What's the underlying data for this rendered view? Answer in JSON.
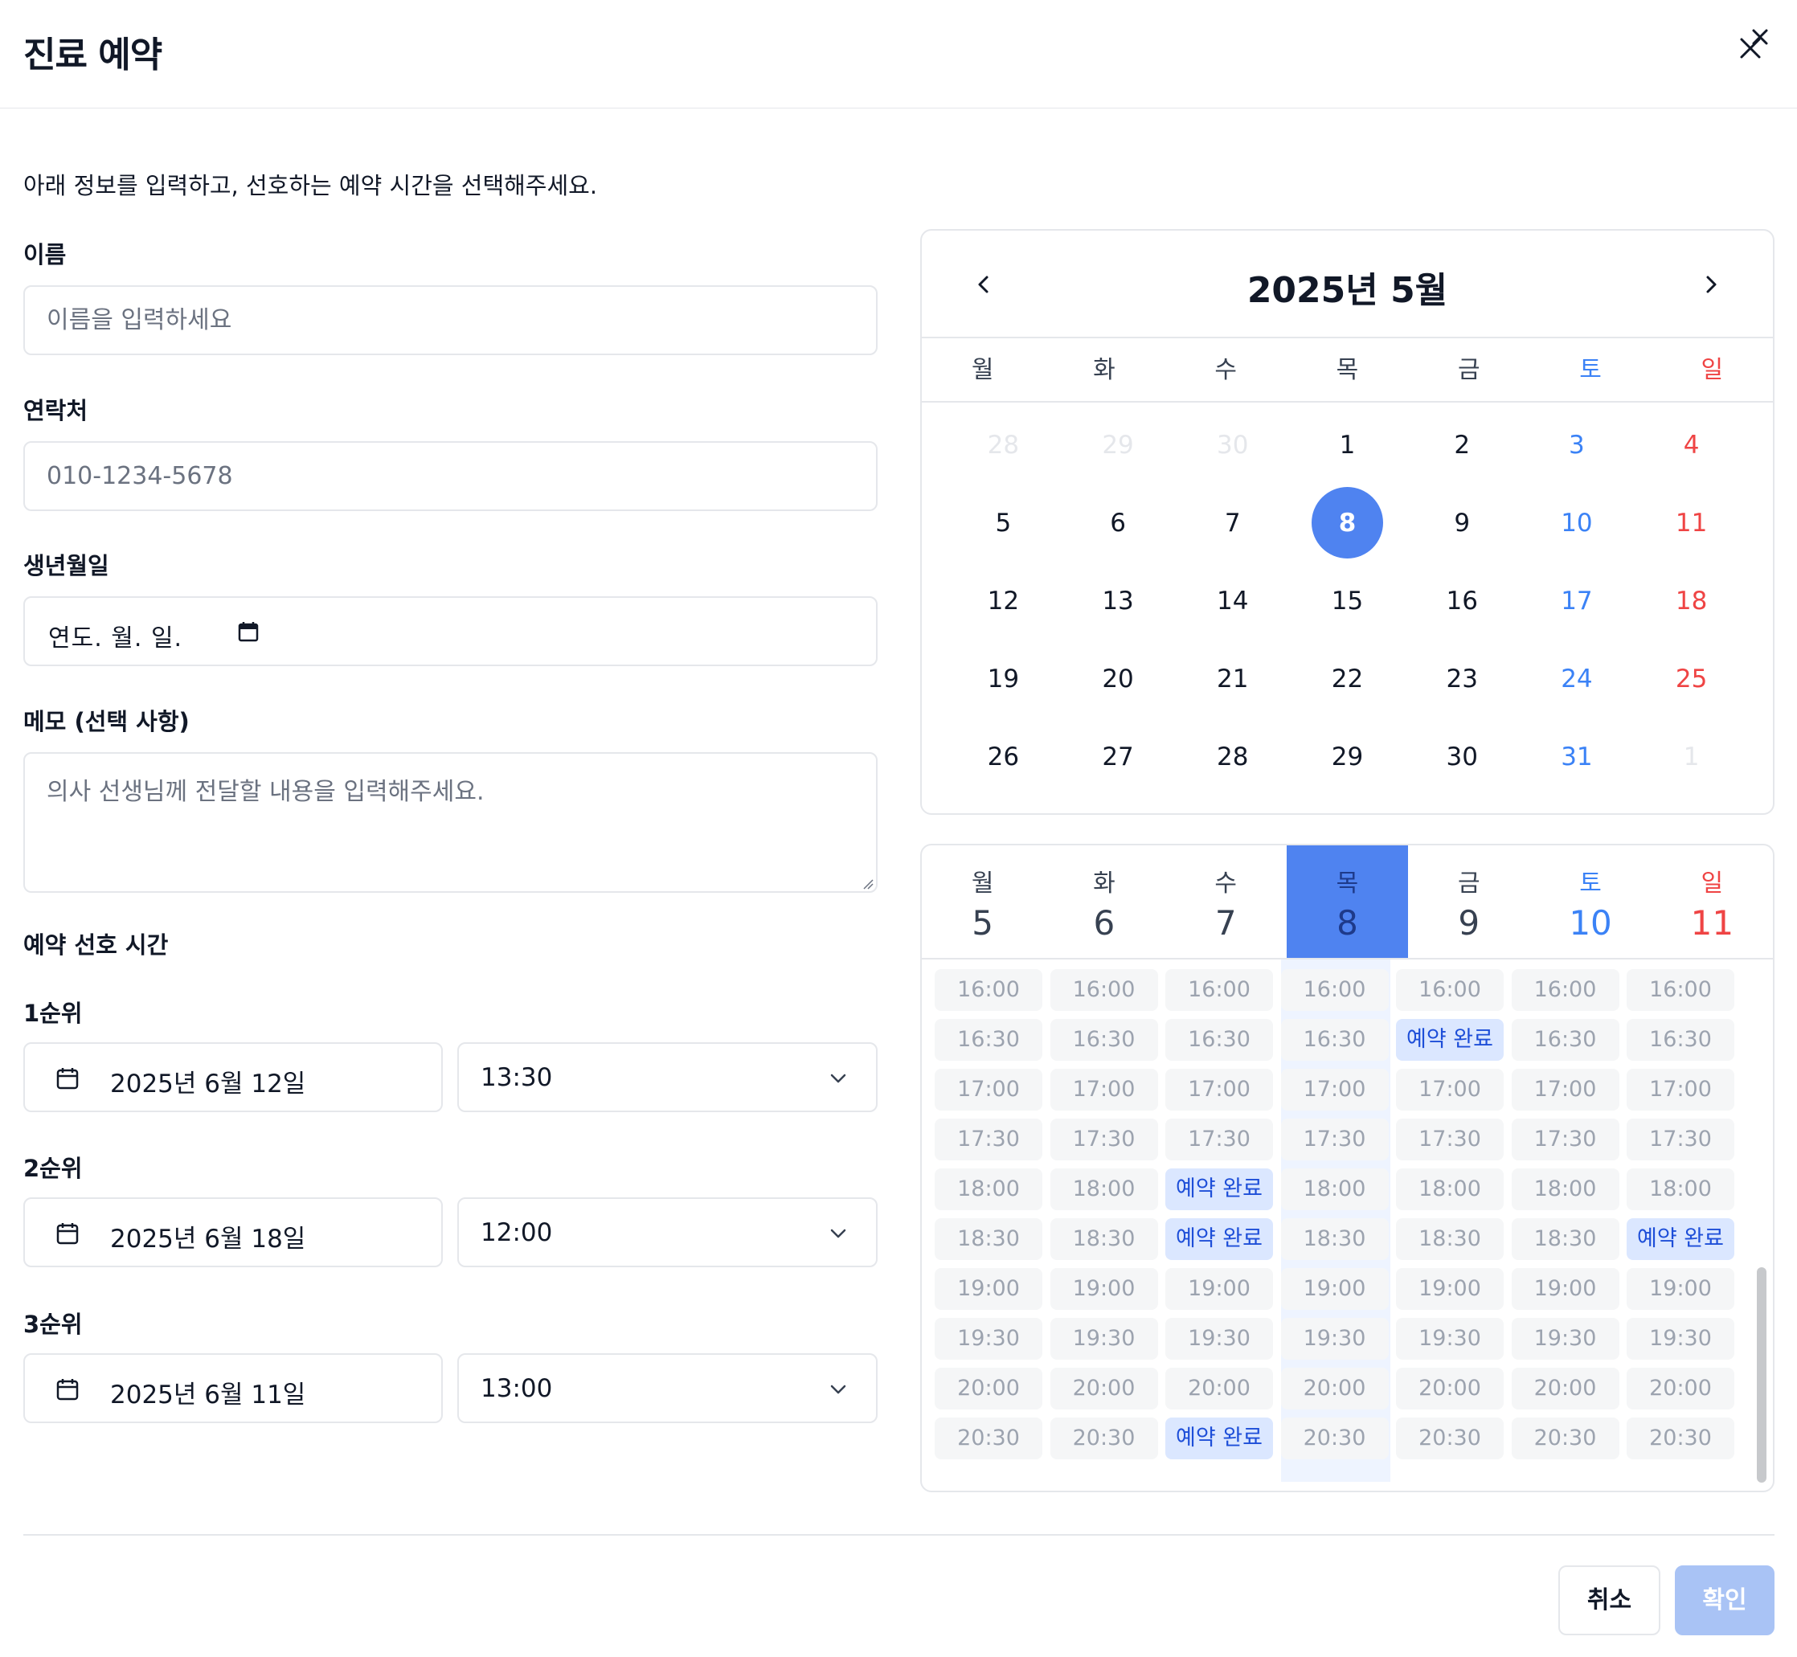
{
  "header": {
    "title": "진료 예약"
  },
  "intro": "아래 정보를 입력하고, 선호하는 예약 시간을 선택해주세요.",
  "form": {
    "name": {
      "label": "이름",
      "placeholder": "이름을 입력하세요"
    },
    "phone": {
      "label": "연락처",
      "placeholder": "010-1234-5678"
    },
    "birth": {
      "label": "생년월일",
      "value": "연도. 월. 일."
    },
    "memo": {
      "label": "메모 (선택 사항)",
      "placeholder": "의사 선생님께 전달할 내용을 입력해주세요."
    }
  },
  "preferences": {
    "title": "예약 선호 시간",
    "items": [
      {
        "rank": "1순위",
        "date": "2025년 6월 12일",
        "time": "13:30"
      },
      {
        "rank": "2순위",
        "date": "2025년 6월 18일",
        "time": "12:00"
      },
      {
        "rank": "3순위",
        "date": "2025년 6월 11일",
        "time": "13:00"
      }
    ]
  },
  "calendar": {
    "title": "2025년 5월",
    "weekdays": [
      "월",
      "화",
      "수",
      "목",
      "금",
      "토",
      "일"
    ],
    "days": [
      "28",
      "29",
      "30",
      "1",
      "2",
      "3",
      "4",
      "5",
      "6",
      "7",
      "8",
      "9",
      "10",
      "11",
      "12",
      "13",
      "14",
      "15",
      "16",
      "17",
      "18",
      "19",
      "20",
      "21",
      "22",
      "23",
      "24",
      "25",
      "26",
      "27",
      "28",
      "29",
      "30",
      "31",
      "1"
    ],
    "selected": "8"
  },
  "week": {
    "days": [
      {
        "name": "월",
        "date": "5"
      },
      {
        "name": "화",
        "date": "6"
      },
      {
        "name": "수",
        "date": "7"
      },
      {
        "name": "목",
        "date": "8"
      },
      {
        "name": "금",
        "date": "9"
      },
      {
        "name": "토",
        "date": "10"
      },
      {
        "name": "일",
        "date": "11"
      }
    ],
    "times": [
      "16:00",
      "16:30",
      "17:00",
      "17:30",
      "18:00",
      "18:30",
      "19:00",
      "19:30",
      "20:00",
      "20:30"
    ],
    "booked_label": "예약 완료",
    "booked": {
      "2": [
        "18:00",
        "18:30",
        "20:30"
      ],
      "4": [
        "16:30"
      ],
      "6": [
        "18:30"
      ]
    }
  },
  "footer": {
    "cancel": "취소",
    "confirm": "확인"
  },
  "colors": {
    "accent": "#4f83f0",
    "saturday": "#3b82f6",
    "sunday": "#ef4444",
    "confirm_disabled": "#a9c3f5"
  }
}
